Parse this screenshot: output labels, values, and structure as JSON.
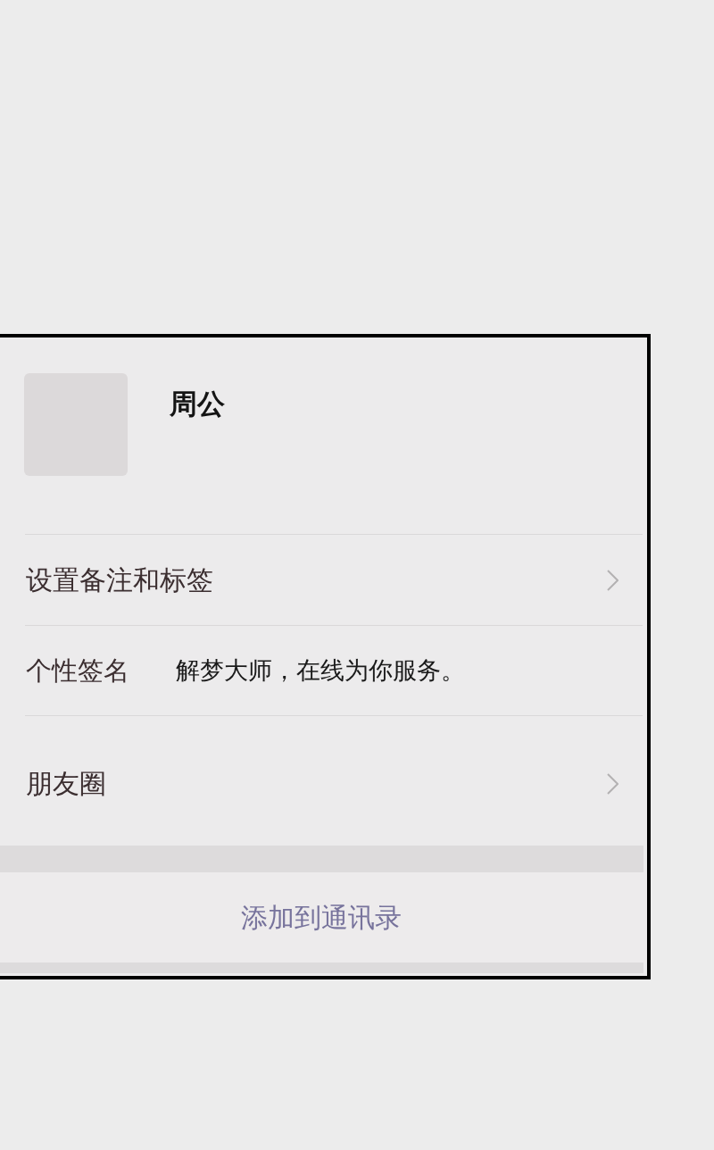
{
  "profile": {
    "name": "周公"
  },
  "rows": [
    {
      "kind": "link",
      "label": "设置备注和标签"
    },
    {
      "kind": "info",
      "label": "个性签名",
      "value": "解梦大师，在线为你服务。"
    },
    {
      "kind": "link",
      "label": "朋友圈"
    }
  ],
  "action_button": {
    "label": "添加到通讯录"
  }
}
